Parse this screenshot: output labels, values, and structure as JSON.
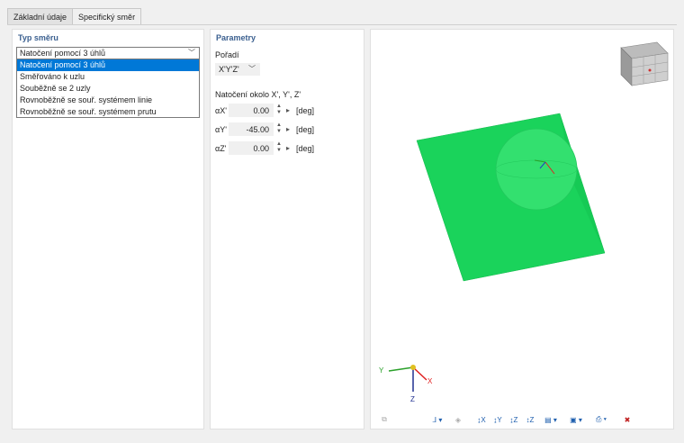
{
  "tabs": [
    {
      "label": "Základní údaje"
    },
    {
      "label": "Specifický směr"
    }
  ],
  "left_panel": {
    "title": "Typ směru",
    "combo_value": "Natočení pomocí 3 úhlů",
    "options": [
      "Natočení pomocí 3 úhlů",
      "Směřováno k uzlu",
      "Souběžně se 2 uzly",
      "Rovnoběžně se souř. systémem linie",
      "Rovnoběžně se souř. systémem prutu"
    ]
  },
  "params_panel": {
    "title": "Parametry",
    "order_label": "Pořadí",
    "order_value": "X'Y'Z'",
    "rotation_label": "Natočení okolo X', Y', Z'",
    "rows": [
      {
        "symbol": "αX'",
        "value": "0.00",
        "unit": "[deg]"
      },
      {
        "symbol": "αY'",
        "value": "-45.00",
        "unit": "[deg]"
      },
      {
        "symbol": "αZ'",
        "value": "0.00",
        "unit": "[deg]"
      }
    ]
  },
  "view": {
    "axes": {
      "y": "Y",
      "x": "X",
      "z": "Z"
    },
    "colors": {
      "plane": "#19d45a",
      "plane_dark": "#10b94a",
      "sphere": "#2ee06c"
    }
  }
}
